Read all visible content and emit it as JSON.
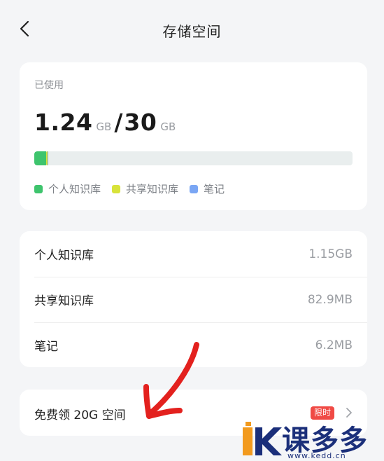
{
  "header": {
    "title": "存储空间",
    "back_icon": "chevron-left-icon"
  },
  "usage": {
    "used_label": "已使用",
    "used_value": "1.24",
    "used_unit": "GB",
    "separator": "/",
    "total_value": "30",
    "total_unit": "GB",
    "progress": {
      "personal_fraction": 0.038,
      "shared_fraction": 0.003,
      "notes_fraction": 0.0002
    },
    "legend": [
      {
        "label": "个人知识库",
        "color": "#3ec46d"
      },
      {
        "label": "共享知识库",
        "color": "#d8e33a"
      },
      {
        "label": "笔记",
        "color": "#7aa6f4"
      }
    ]
  },
  "breakdown": [
    {
      "name": "个人知识库",
      "value": "1.15GB"
    },
    {
      "name": "共享知识库",
      "value": "82.9MB"
    },
    {
      "name": "笔记",
      "value": "6.2MB"
    }
  ],
  "promo": {
    "text": "免费领 20G 空间",
    "badge": "限时",
    "chevron_icon": "chevron-right-icon"
  },
  "overlay": {
    "arrow_icon": "red-hand-drawn-arrow-icon",
    "arrow_color": "#e3211e"
  },
  "watermark": {
    "text": "课多多",
    "url": "www.kedd.cn",
    "logo_icon": "k-logo-icon",
    "accent": "#f29a1e"
  }
}
